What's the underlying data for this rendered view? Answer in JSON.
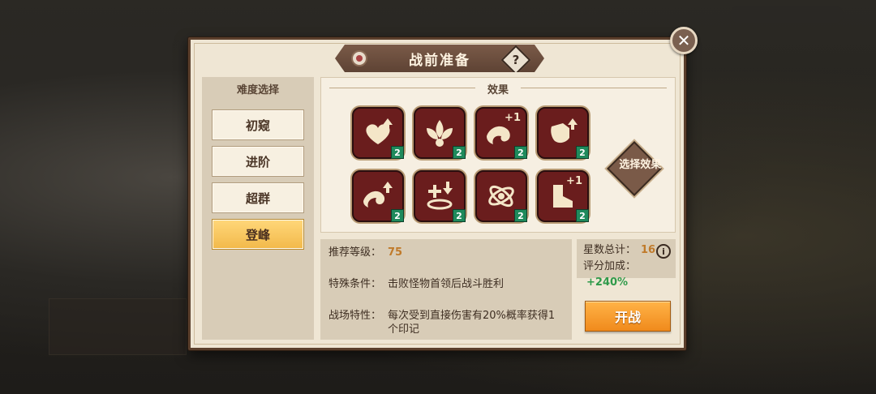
{
  "dialog": {
    "title": "战前准备",
    "help_label": "?",
    "close_label": "✕"
  },
  "difficulty": {
    "header": "难度选择",
    "options": [
      "初窥",
      "进阶",
      "超群",
      "登峰"
    ],
    "selected": "登峰"
  },
  "effects": {
    "header": "效果",
    "select_label": "选择效果",
    "icons": [
      {
        "name": "heart-up-icon",
        "badge": "2",
        "plus": ""
      },
      {
        "name": "lotus-icon",
        "badge": "2",
        "plus": ""
      },
      {
        "name": "wave-plus-icon",
        "badge": "2",
        "plus": "+1"
      },
      {
        "name": "shield-up-icon",
        "badge": "2",
        "plus": ""
      },
      {
        "name": "wave-up-icon",
        "badge": "2",
        "plus": ""
      },
      {
        "name": "heal-down-icon",
        "badge": "2",
        "plus": ""
      },
      {
        "name": "orbit-icon",
        "badge": "2",
        "plus": ""
      },
      {
        "name": "boot-plus-icon",
        "badge": "2",
        "plus": "+1"
      }
    ]
  },
  "info": {
    "rec_level_label": "推荐等级：",
    "rec_level_value": "75",
    "special_label": "特殊条件：",
    "special_value": "击败怪物首领后战斗胜利",
    "field_label": "战场特性：",
    "field_value": "每次受到直接伤害有20%概率获得1个印记"
  },
  "stars": {
    "total_label": "星数总计：",
    "total_value": "16",
    "bonus_label": "评分加成：",
    "bonus_value": "+240%",
    "info_label": "i"
  },
  "start_label": "开战",
  "colors": {
    "accent_orange": "#f08a1c",
    "selected_gold": "#f2b94a",
    "icon_bg": "#6a1d1d",
    "badge_green": "#1f8a5c"
  }
}
